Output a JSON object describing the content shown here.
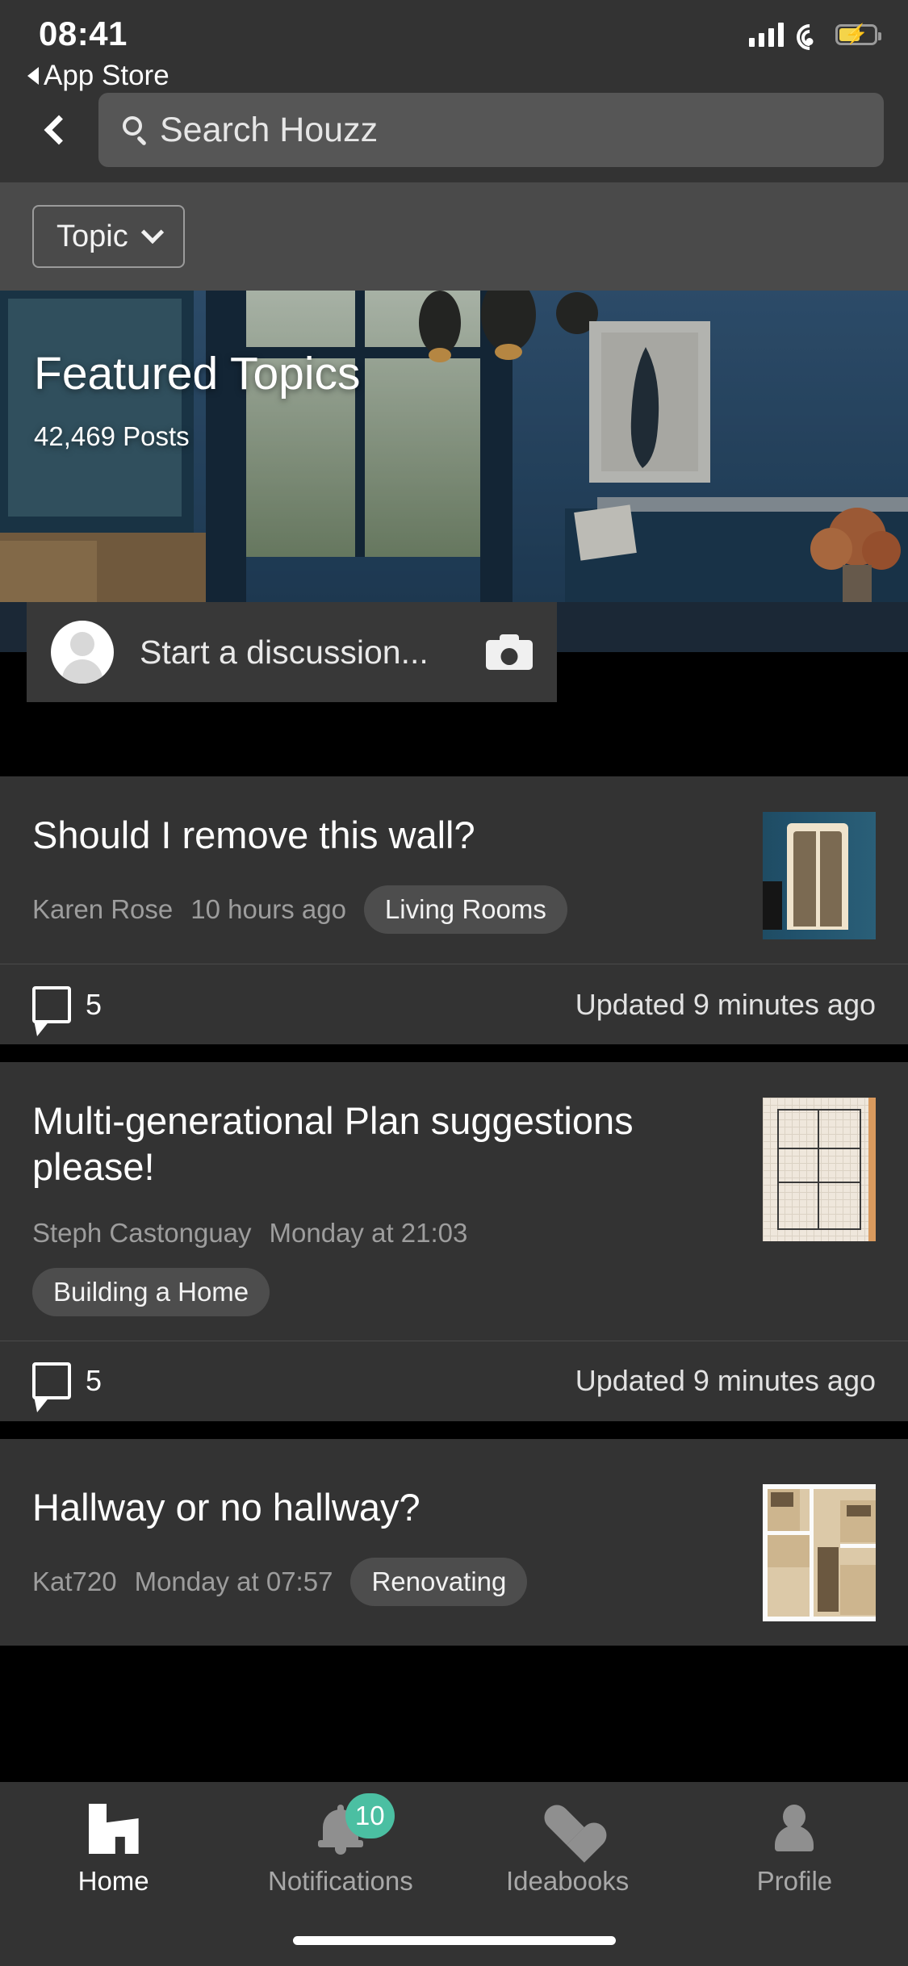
{
  "status_bar": {
    "time": "08:41",
    "return_app": "App Store",
    "icons": {
      "signal": "signal-bars-icon",
      "wifi": "wifi-icon",
      "battery": "battery-charging-icon"
    },
    "battery_charging": true,
    "battery_color": "#f4d44a"
  },
  "nav": {
    "back_icon": "chevron-left-icon",
    "search_placeholder": "Search Houzz",
    "search_icon": "search-icon",
    "search_value": ""
  },
  "filter": {
    "topic_label": "Topic",
    "chevron_icon": "chevron-down-icon"
  },
  "hero": {
    "title": "Featured Topics",
    "posts_count": "42,469 Posts"
  },
  "composer": {
    "placeholder": "Start a discussion...",
    "avatar_icon": "avatar-placeholder-icon",
    "camera_icon": "camera-icon"
  },
  "discussions": [
    {
      "title": "Should I remove this wall?",
      "author": "Karen Rose",
      "time": "10 hours ago",
      "tag": "Living Rooms",
      "tag_inline": true,
      "comment_icon": "comment-bubble-icon",
      "comments": "5",
      "updated": "Updated 9 minutes ago",
      "thumb": "door-blue-wall-photo"
    },
    {
      "title": "Multi-generational Plan suggestions please!",
      "author": "Steph Castonguay",
      "time": "Monday at 21:03",
      "tag": "Building a Home",
      "tag_inline": false,
      "comment_icon": "comment-bubble-icon",
      "comments": "5",
      "updated": "Updated 9 minutes ago",
      "thumb": "hand-drawn-floorplan-photo"
    },
    {
      "title": "Hallway or no hallway?",
      "author": "Kat720",
      "time": "Monday at 07:57",
      "tag": "Renovating",
      "tag_inline": true,
      "thumb": "rendered-floorplan-photo"
    }
  ],
  "tabbar": {
    "accent_badge_color": "#4bbfa2",
    "items": [
      {
        "label": "Home",
        "icon": "houzz-home-icon",
        "active": true,
        "badge": ""
      },
      {
        "label": "Notifications",
        "icon": "bell-icon",
        "active": false,
        "badge": "10"
      },
      {
        "label": "Ideabooks",
        "icon": "heart-icon",
        "active": false,
        "badge": ""
      },
      {
        "label": "Profile",
        "icon": "person-icon",
        "active": false,
        "badge": ""
      }
    ]
  }
}
